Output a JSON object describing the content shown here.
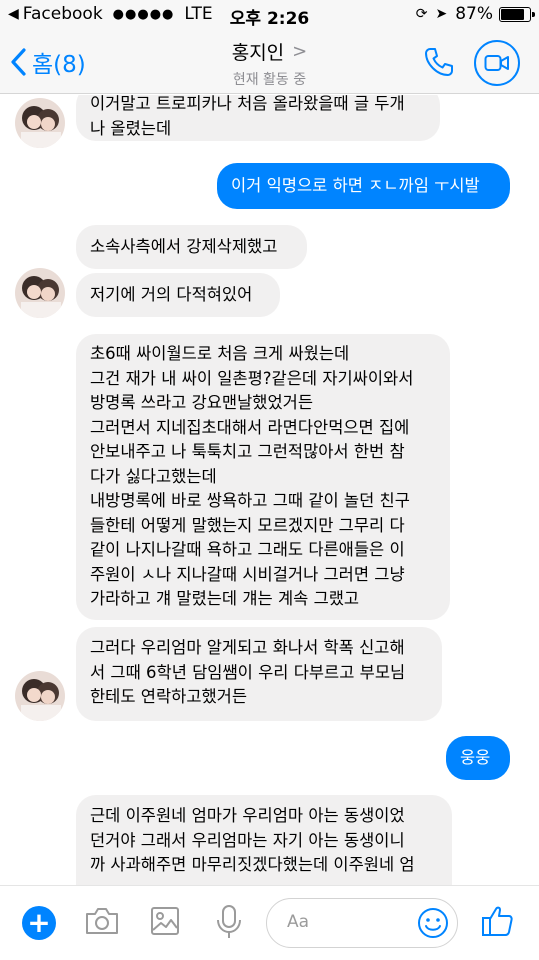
{
  "status_bar": {
    "back_app": "Facebook",
    "signal": "●●●●●",
    "network": "LTE",
    "time": "오후 2:26",
    "battery_text": "87%",
    "battery_level": 0.87
  },
  "header": {
    "back_label": "홈(8)",
    "contact_name": "홍지인",
    "chevron": ">",
    "status": "현재 활동 중"
  },
  "messages": [
    {
      "side": "in",
      "text": "이거말고 트로피카나 처음 올라왔을때 글 두개\n나 올렸는데"
    },
    {
      "side": "out",
      "text": "이거 익명으로 하면 ㅈㄴ까임 ㅜ시발"
    },
    {
      "side": "in",
      "text": "소속사측에서 강제삭제했고"
    },
    {
      "side": "in",
      "text": "저기에 거의 다적혀있어"
    },
    {
      "side": "in",
      "text": "초6때 싸이월드로 처음 크게 싸웠는데\n그건 재가 내 싸이 일촌평?같은데 자기싸이와서\n방명록 쓰라고 강요맨날했었거든\n그러면서 지네집초대해서 라면다안먹으면 집에\n안보내주고 나 툭툭치고 그런적많아서 한번 참\n다가 싫다고했는데\n내방명록에 바로 쌍욕하고 그때 같이 놀던 친구\n들한테 어떻게 말했는지 모르겠지만 그무리 다\n같이 나지나갈때 욕하고 그래도 다른애들은 이\n주원이 ㅅ나 지나갈때 시비걸거나 그러면 그냥\n가라하고 걔 말렸는데 걔는 계속 그랬고"
    },
    {
      "side": "in",
      "text": "그러다 우리엄마 알게되고 화나서 학폭 신고해\n서 그때 6학년 담임쌤이 우리 다부르고 부모님\n한테도 연락하고했거든"
    },
    {
      "side": "out",
      "text": "웅웅"
    },
    {
      "side": "in",
      "text": "근데 이주원네 엄마가 우리엄마 아는 동생이었\n던거야 그래서 우리엄마는 자기 아는 동생이니\n까 사과해주면 마무리짓겠다했는데 이주원네 엄"
    }
  ],
  "composer": {
    "placeholder": "Aa"
  },
  "colors": {
    "accent": "#0084ff",
    "incoming_bubble": "#f1f0f0"
  },
  "icons": [
    "plus-icon",
    "camera-icon",
    "image-icon",
    "microphone-icon",
    "emoji-icon",
    "thumbs-up-icon",
    "phone-icon",
    "video-icon",
    "chevron-left-icon"
  ]
}
